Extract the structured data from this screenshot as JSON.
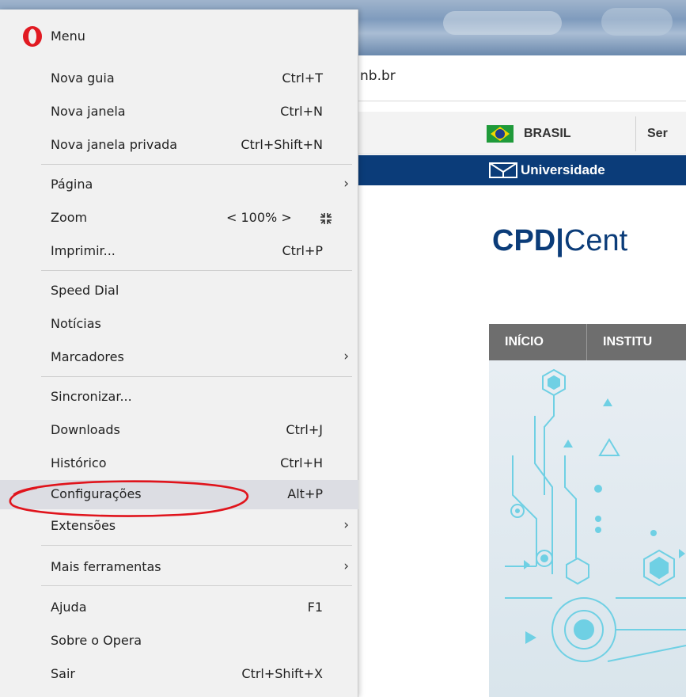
{
  "browser": {
    "address_text": "nb.br"
  },
  "website": {
    "gov_label": "BRASIL",
    "gov_services": "Ser",
    "university": "Universidade",
    "logo_bold": "CPD",
    "logo_sep": "|",
    "logo_rest": "Cent",
    "nav": [
      "INÍCIO",
      "INSTITU"
    ]
  },
  "menu": {
    "title": "Menu",
    "groups": [
      [
        {
          "label": "Nova guia",
          "shortcut": "Ctrl+T"
        },
        {
          "label": "Nova janela",
          "shortcut": "Ctrl+N"
        },
        {
          "label": "Nova janela privada",
          "shortcut": "Ctrl+Shift+N"
        }
      ],
      [
        {
          "label": "Página",
          "shortcut": "",
          "submenu": true
        },
        {
          "label": "Zoom",
          "zoom": "< 100% >"
        },
        {
          "label": "Imprimir...",
          "shortcut": "Ctrl+P"
        }
      ],
      [
        {
          "label": "Speed Dial",
          "shortcut": ""
        },
        {
          "label": "Notícias",
          "shortcut": ""
        },
        {
          "label": "Marcadores",
          "shortcut": "",
          "submenu": true
        }
      ],
      [
        {
          "label": "Sincronizar...",
          "shortcut": ""
        },
        {
          "label": "Downloads",
          "shortcut": "Ctrl+J"
        },
        {
          "label": "Histórico",
          "shortcut": "Ctrl+H"
        },
        {
          "label": "Configurações",
          "shortcut": "Alt+P",
          "highlighted": true
        },
        {
          "label": "Extensões",
          "shortcut": "",
          "submenu": true
        }
      ],
      [
        {
          "label": "Mais ferramentas",
          "shortcut": "",
          "submenu": true
        }
      ],
      [
        {
          "label": "Ajuda",
          "shortcut": "F1"
        },
        {
          "label": "Sobre o Opera",
          "shortcut": ""
        },
        {
          "label": "Sair",
          "shortcut": "Ctrl+Shift+X"
        }
      ]
    ]
  },
  "colors": {
    "opera_red": "#e11a22",
    "annotation_red": "#e0141c",
    "unb_blue": "#0b3c79"
  }
}
